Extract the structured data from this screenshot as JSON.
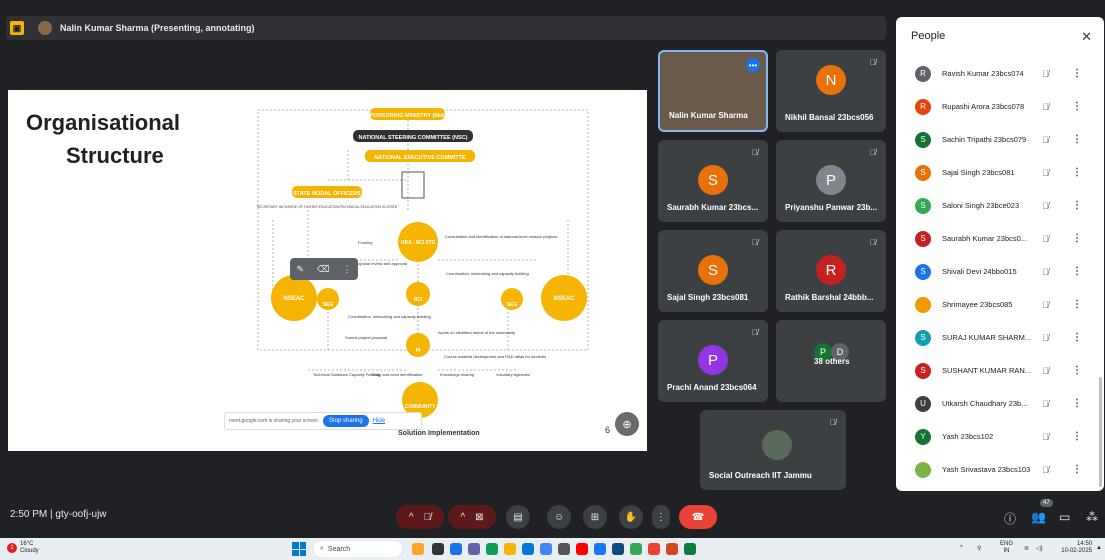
{
  "presenter_bar": {
    "text": "Nalin Kumar Sharma (Presenting, annotating)"
  },
  "slide": {
    "title_line1": "Organisational",
    "title_line2": "Structure",
    "footer": "Solution Implementation",
    "page_number": "6",
    "boxes": {
      "ministry": "SPONSORING MINISTRY (MoE)",
      "nsc": "NATIONAL STEERING COMMITTEE (NSC)",
      "nec": "NATIONAL EXECUTIVE COMMITTE",
      "sno": "STATE NODAL OFFICERS",
      "sno_sub": "SECRETARY INCHARGE OF HIGHER EDUCATION/TECHNICAL EDUCATION IN STATE"
    },
    "nodes": {
      "uba": "UBA - NCI IITD",
      "rci": "RCI",
      "pi": "PI",
      "nseac_left": "NSEAC",
      "nseac_right": "NSEAC",
      "seg_left": "SEG",
      "seg_right": "SEG",
      "community": "COMMUNITY"
    },
    "labels": {
      "funding": "Funding",
      "project_proposal": "Project proposal review and approval",
      "consultation": "Consultation and identification of national-level mission projects",
      "coordination1": "Coordination, networking and capacity building",
      "coordination2": "Coordination, networking and capacity building",
      "submit": "Submit project proposal",
      "inputs": "Inputs on identified needs of the community",
      "course": "Course material development and R&D ideas for students",
      "technical": "Technical Guidance Capacity Funding",
      "study": "Study and need identification",
      "knowledge": "Knowledge sharing",
      "voluntary": "Voluntary Agencies"
    },
    "share_notice": {
      "text": "meet.google.com is sharing your screen.",
      "stop": "Stop sharing",
      "hide": "Hide"
    }
  },
  "tiles": [
    {
      "name": "Nalin Kumar Sharma"
    },
    {
      "name": "Nikhil Bansal 23bcs056",
      "initial": "N",
      "color": "#e8710a"
    },
    {
      "name": "Saurabh Kumar 23bcs...",
      "initial": "S",
      "color": "#e8710a"
    },
    {
      "name": "Priyanshu Panwar 23b...",
      "initial": "P",
      "color": "#80868b"
    },
    {
      "name": "Sajal Singh 23bcs081",
      "initial": "S",
      "color": "#e8710a"
    },
    {
      "name": "Rathik Barshal 24bbb...",
      "initial": "R",
      "color": "#c5221f"
    },
    {
      "name": "Prachi Anand 23bcs064",
      "initial": "P",
      "color": "#9334e6"
    },
    {
      "name": "38 others",
      "initial_a": "P",
      "initial_b": "D"
    },
    {
      "name": "Social Outreach IIT Jammu"
    }
  ],
  "people_panel": {
    "title": "People",
    "close": "✕",
    "participants": [
      {
        "name": "Ravish Kumar 23bcs074",
        "initial": "R",
        "color": "#5f6368"
      },
      {
        "name": "Rupashi Arora 23bcs078",
        "initial": "R",
        "color": "#e8430a"
      },
      {
        "name": "Sachin Tripathi 23bcs079",
        "initial": "S",
        "color": "#137333"
      },
      {
        "name": "Sajal Singh 23bcs081",
        "initial": "S",
        "color": "#e8710a"
      },
      {
        "name": "Saloni Singh 23bce023",
        "initial": "S",
        "color": "#34a853"
      },
      {
        "name": "Saurabh Kumar 23bcs0...",
        "initial": "S",
        "color": "#c5221f"
      },
      {
        "name": "Shivali Devi 24bbo015",
        "initial": "S",
        "color": "#1a73e8"
      },
      {
        "name": "Shrimayee 23bcs085",
        "initial": "",
        "color": "#f29900"
      },
      {
        "name": "SURAJ KUMAR SHARM...",
        "initial": "S",
        "color": "#129eaf"
      },
      {
        "name": "SUSHANT KUMAR RAN...",
        "initial": "S",
        "color": "#c5221f"
      },
      {
        "name": "Utkarsh Chaudhary 23b...",
        "initial": "U",
        "color": "#3c4043"
      },
      {
        "name": "Yash 23bcs102",
        "initial": "Y",
        "color": "#137333"
      },
      {
        "name": "Yash Srivastava 23bcs103",
        "initial": "",
        "color": "#7cb342"
      }
    ]
  },
  "bottom": {
    "meeting": "2:50 PM | gty-oofj-ujw",
    "people_count": "47"
  },
  "taskbar": {
    "temp": "16°C",
    "weather": "Cloudy",
    "search": "Search",
    "lang1": "ENG",
    "lang2": "IN",
    "time": "14:50",
    "date": "10-02-2025"
  }
}
